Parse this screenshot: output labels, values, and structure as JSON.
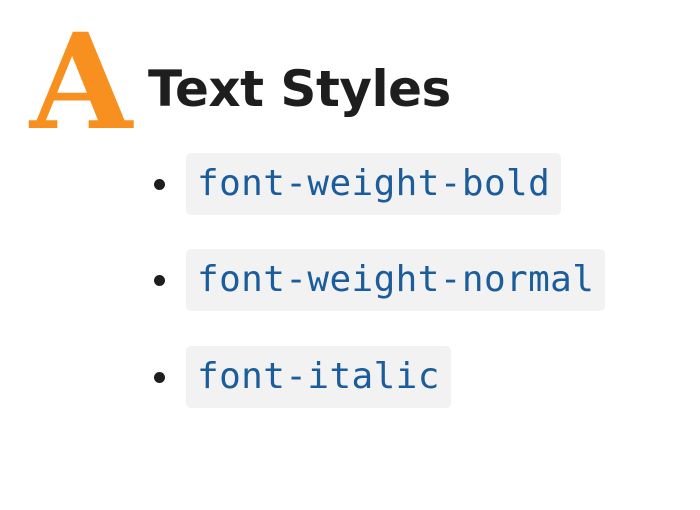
{
  "logo": {
    "letter": "A"
  },
  "title": "Text Styles",
  "items": [
    {
      "label": "font-weight-bold"
    },
    {
      "label": "font-weight-normal"
    },
    {
      "label": "font-italic"
    }
  ],
  "colors": {
    "logo": "#f7901e",
    "title": "#1e1e1e",
    "bullet": "#1e1e1e",
    "code_text": "#1b5c9b",
    "code_bg": "#f2f2f2"
  }
}
